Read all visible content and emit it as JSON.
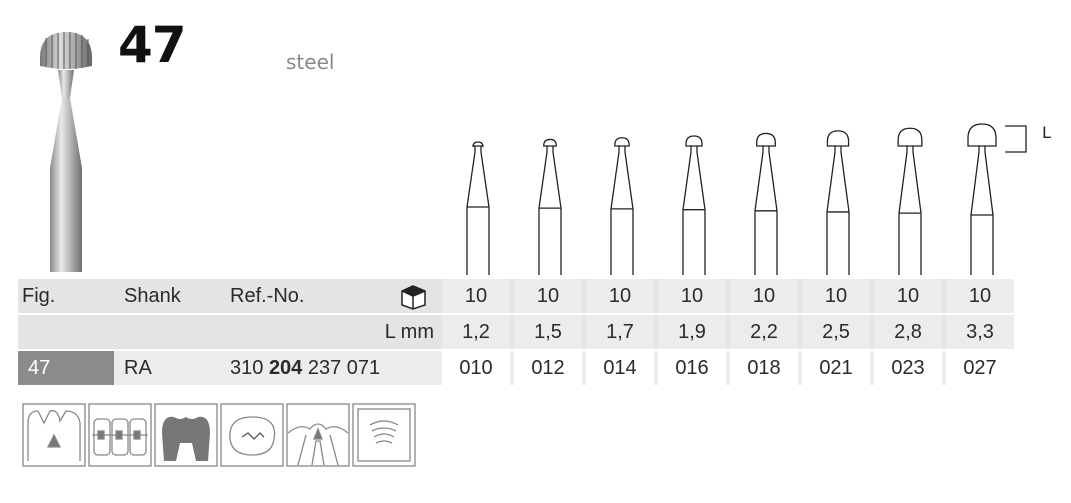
{
  "header": {
    "fig_number": "47",
    "material": "steel"
  },
  "dimension_label": "L",
  "table": {
    "headers": {
      "fig": "Fig.",
      "shank": "Shank",
      "ref": "Ref.-No."
    },
    "pack_icon": "package-box-icon",
    "pack_values": [
      "10",
      "10",
      "10",
      "10",
      "10",
      "10",
      "10",
      "10"
    ],
    "length_label": "L mm",
    "lengths": [
      "1,2",
      "1,5",
      "1,7",
      "1,9",
      "2,2",
      "2,5",
      "2,8",
      "3,3"
    ],
    "row": {
      "fig": "47",
      "shank": "RA",
      "ref_prefix": "310",
      "ref_bold": "204",
      "ref_suffix": "237 071",
      "sizes": [
        "010",
        "012",
        "014",
        "016",
        "018",
        "021",
        "023",
        "027"
      ]
    }
  },
  "use_icons": [
    "cavity-prep-icon",
    "crown-bridge-icon",
    "molar-icon",
    "endodontic-access-icon",
    "root-canal-icon",
    "surgical-icon"
  ]
}
